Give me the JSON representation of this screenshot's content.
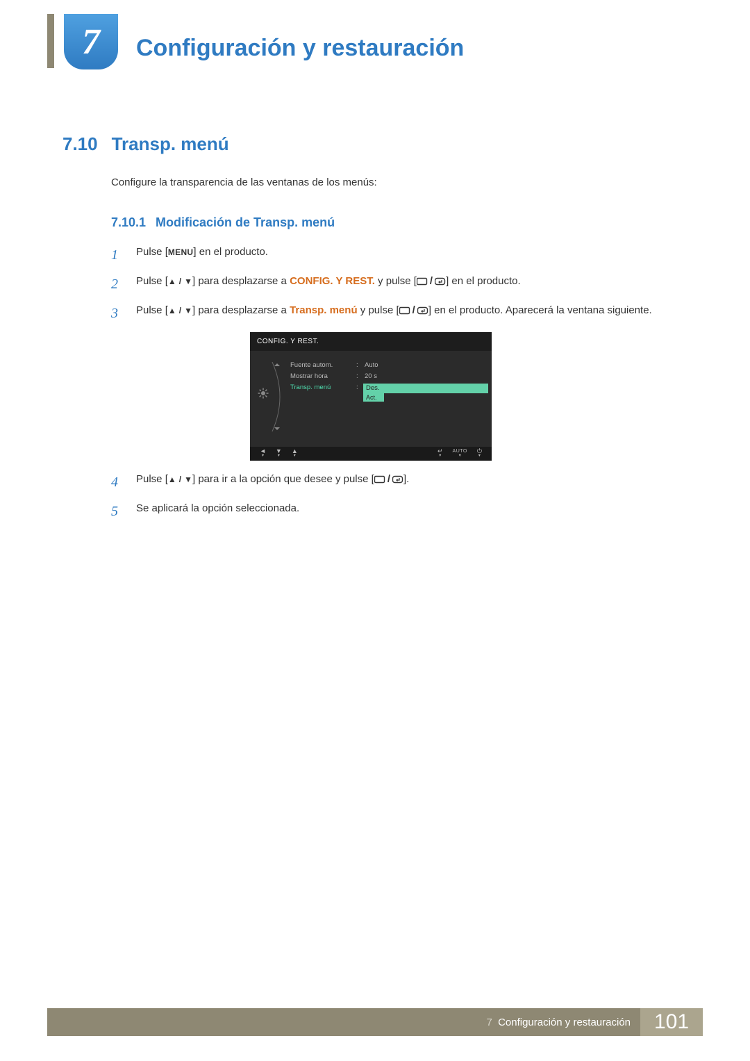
{
  "chapter": {
    "number": "7",
    "title": "Configuración y restauración"
  },
  "section": {
    "number": "7.10",
    "title": "Transp. menú",
    "intro": "Configure la transparencia de las ventanas de los menús:"
  },
  "subsection": {
    "number": "7.10.1",
    "title": "Modificación de Transp. menú"
  },
  "steps": [
    {
      "num": "1",
      "pre": "Pulse [",
      "menu_key": "MENU",
      "post": "] en el producto."
    },
    {
      "num": "2",
      "pre": "Pulse [",
      "mid1": "] para desplazarse a ",
      "orange": "CONFIG. Y REST.",
      "mid2": " y pulse [",
      "post": "] en el producto."
    },
    {
      "num": "3",
      "pre": "Pulse [",
      "mid1": "] para desplazarse a ",
      "orange": "Transp. menú",
      "mid2": " y pulse [",
      "post": "] en el producto. Aparecerá la ventana siguiente."
    },
    {
      "num": "4",
      "pre": "Pulse [",
      "mid1": "] para ir a la opción que desee y pulse [",
      "post": "]."
    },
    {
      "num": "5",
      "text": "Se aplicará la opción seleccionada."
    }
  ],
  "osd": {
    "title": "CONFIG. Y REST.",
    "rows": [
      {
        "label": "Fuente autom.",
        "value": "Auto"
      },
      {
        "label": "Mostrar hora",
        "value": "20 s"
      }
    ],
    "active_label": "Transp. menú",
    "dropdown_selected": "Des.",
    "dropdown_other": "Act.",
    "footer_auto": "AUTO"
  },
  "footer": {
    "chapter_ref": "7",
    "chapter_title": "Configuración y restauración",
    "page_number": "101"
  }
}
